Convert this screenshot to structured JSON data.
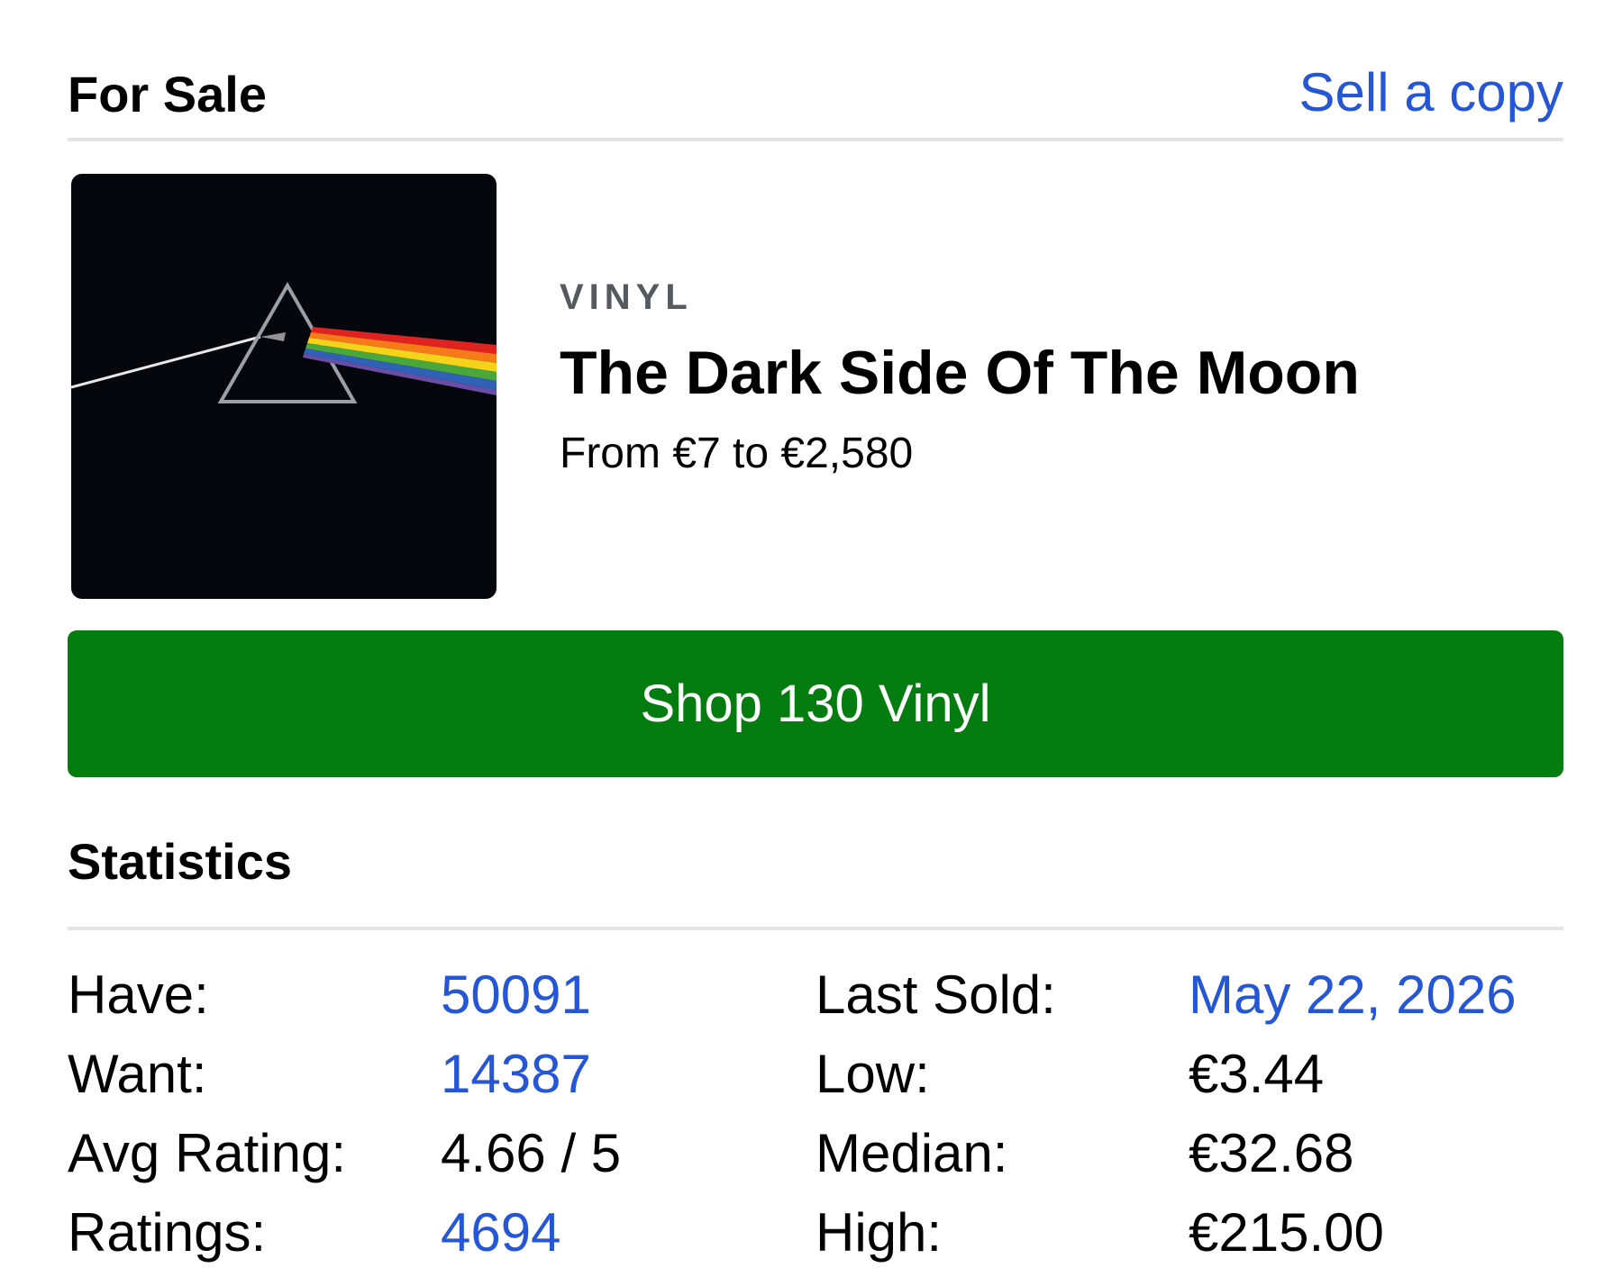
{
  "for_sale": {
    "title": "For Sale",
    "sell_link": "Sell a copy"
  },
  "release": {
    "format": "VINYL",
    "title": "The Dark Side Of The Moon",
    "price_range": "From €7 to €2,580",
    "cover_icon": "album-cover-image"
  },
  "shop_button": {
    "label": "Shop 130 Vinyl",
    "color": "#047c10"
  },
  "statistics": {
    "title": "Statistics",
    "left": [
      {
        "label": "Have:",
        "value": "50091",
        "link": true
      },
      {
        "label": "Want:",
        "value": "14387",
        "link": true
      },
      {
        "label": "Avg Rating:",
        "value": "4.66 / 5",
        "link": false
      },
      {
        "label": "Ratings:",
        "value": "4694",
        "link": true
      }
    ],
    "right": [
      {
        "label": "Last Sold:",
        "value": "May 22, 2026",
        "link": true
      },
      {
        "label": "Low:",
        "value": "€3.44",
        "link": false
      },
      {
        "label": "Median:",
        "value": "€32.68",
        "link": false
      },
      {
        "label": "High:",
        "value": "€215.00",
        "link": false
      }
    ]
  },
  "colors": {
    "link": "#2456d6",
    "divider": "#e4e4e4",
    "format_label": "#555a60"
  }
}
